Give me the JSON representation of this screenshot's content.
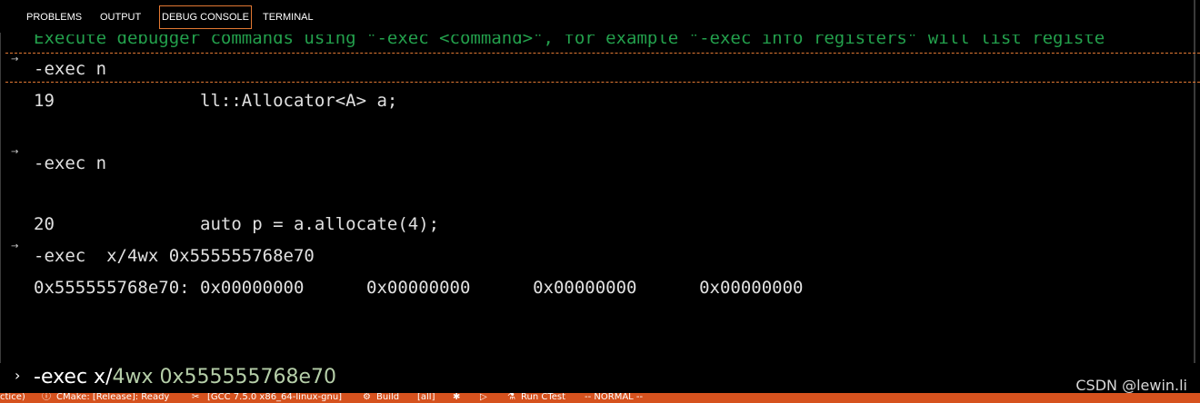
{
  "tabs": [
    {
      "label": "PROBLEMS"
    },
    {
      "label": "OUTPUT"
    },
    {
      "label": "DEBUG CONSOLE",
      "active": true
    },
    {
      "label": "TERMINAL"
    }
  ],
  "console": {
    "info": "Execute debugger commands using \"-exec <command>\", for example \"-exec info registers\" will list registe",
    "lines": [
      "-exec n",
      "19              ll::Allocator<A> a;",
      "-exec n",
      "20              auto p = a.allocate(4);",
      "-exec  x/4wx 0x555555768e70",
      "0x555555768e70: 0x00000000      0x00000000      0x00000000      0x00000000"
    ]
  },
  "input": {
    "cmd": "-exec x/",
    "arg": "4wx 0x555555768e70"
  },
  "watermark": "CSDN @lewin.li",
  "status": {
    "left_fragment": "ctice)",
    "cmake": "CMake: [Release]: Ready",
    "kit": "[GCC 7.5.0 x86_64-linux-gnu]",
    "build": "Build",
    "target": "[all]",
    "run_ctest": "Run CTest",
    "mode": "-- NORMAL --"
  },
  "icons": {
    "gutter_arrow": "→",
    "input_chevron": "›",
    "info_icon": "ⓘ",
    "kit_icon": "✂",
    "build_icon": "⚙",
    "debug_icon": "✱",
    "run_icon": "▷",
    "ctest_icon": "⚗"
  },
  "colors": {
    "accent": "#e37933",
    "status_bg": "#d6521e",
    "info_text": "#23a04c"
  }
}
